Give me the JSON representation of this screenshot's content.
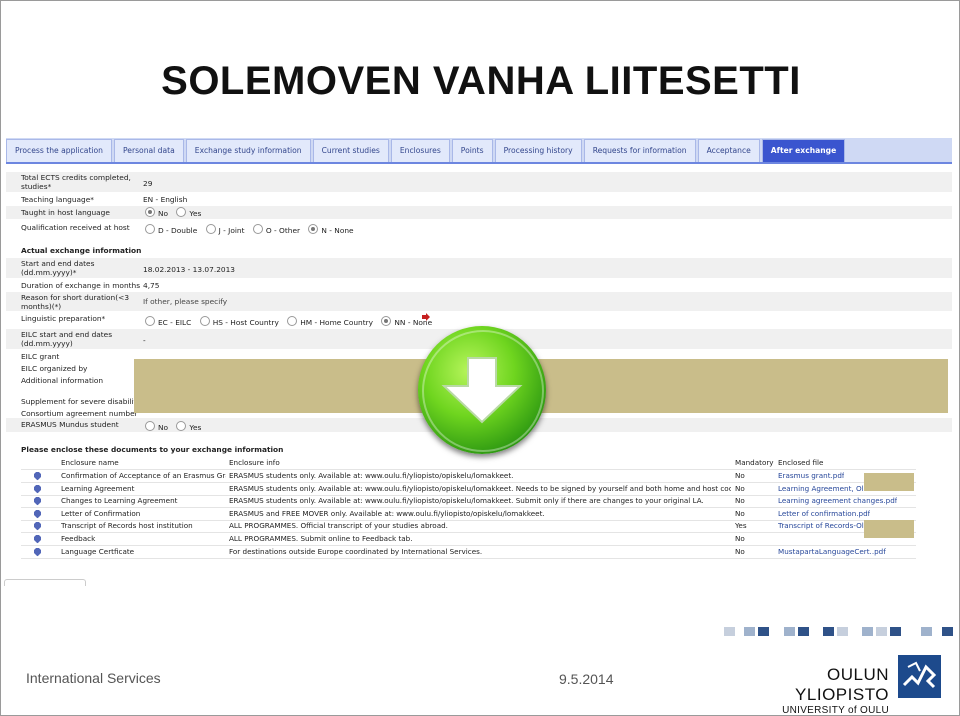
{
  "slide": {
    "title": "SOLEMOVEN VANHA LIITESETTI",
    "footer_left": "International Services",
    "footer_date": "9.5.2014",
    "university_name": "OULUN YLIOPISTO",
    "university_name_en": "UNIVERSITY of OULU",
    "accent_color": "#3a55cf",
    "redaction_color": "#c9bd8a"
  },
  "tabs": [
    {
      "label": "Process the application",
      "active": false
    },
    {
      "label": "Personal data",
      "active": false
    },
    {
      "label": "Exchange study information",
      "active": false
    },
    {
      "label": "Current studies",
      "active": false
    },
    {
      "label": "Enclosures",
      "active": false
    },
    {
      "label": "Points",
      "active": false
    },
    {
      "label": "Processing history",
      "active": false
    },
    {
      "label": "Requests for information",
      "active": false
    },
    {
      "label": "Acceptance",
      "active": false
    },
    {
      "label": "After exchange",
      "active": true
    }
  ],
  "form": {
    "total_ects_label": "Total ECTS credits completed, studies*",
    "total_ects_value": "29",
    "teaching_language_label": "Teaching language*",
    "teaching_language_value": "EN - English",
    "taught_host_label": "Taught in host language",
    "taught_host_options": [
      "No",
      "Yes"
    ],
    "qualification_label": "Qualification received at host",
    "qualification_options": [
      "D - Double",
      "J - Joint",
      "O - Other",
      "N - None"
    ],
    "actual_exchange_heading": "Actual exchange information",
    "start_end_label": "Start and end dates (dd.mm.yyyy)*",
    "start_end_value": "18.02.2013 - 13.07.2013",
    "duration_label": "Duration of exchange in months",
    "duration_value": "4,75",
    "short_reason_label": "Reason for short duration(<3 months)(*)",
    "short_reason_value": "If other, please specify",
    "linguistic_label": "Linguistic preparation*",
    "linguistic_options": [
      "EC - EILC",
      "HS - Host Country",
      "HM - Home Country",
      "NN - None"
    ],
    "eilc_dates_label": "EILC start and end dates (dd.mm.yyyy)",
    "eilc_dates_value": "-",
    "eilc_grant_label": "EILC grant",
    "eilc_org_label": "EILC organized by",
    "additional_label": "Additional information",
    "severe_label": "Supplement for severe disability",
    "consortium_label": "Consortium agreement number",
    "erasmus_mundus_label": "ERASMUS Mundus student",
    "erasmus_mundus_options": [
      "No",
      "Yes"
    ],
    "enclose_heading": "Please enclose these documents to your exchange information"
  },
  "enclosures": {
    "columns": [
      "Enclosure name",
      "Enclosure info",
      "Mandatory",
      "Enclosed file"
    ],
    "rows": [
      {
        "name": "Confirmation of Acceptance of an Erasmus Grant",
        "info": "ERASMUS students only. Available at: www.oulu.fi/yliopisto/opiskelu/lomakkeet.",
        "mandatory": "No",
        "file": "Erasmus grant.pdf"
      },
      {
        "name": "Learning Agreement",
        "info": "ERASMUS students only. Available at: www.oulu.fi/yliopisto/opiskelu/lomakkeet. Needs to be signed by yourself and both home and host coordinators.",
        "mandatory": "No",
        "file": "Learning Agreement, Olli"
      },
      {
        "name": "Changes to Learning Agreement",
        "info": "ERASMUS students only. Available at: www.oulu.fi/yliopisto/opiskelu/lomakkeet. Submit only if there are changes to your original LA.",
        "mandatory": "No",
        "file": "Learning agreement changes.pdf"
      },
      {
        "name": "Letter of Confirmation",
        "info": "ERASMUS and FREE MOVER only. Available at: www.oulu.fi/yliopisto/opiskelu/lomakkeet.",
        "mandatory": "No",
        "file": "Letter of confirmation.pdf"
      },
      {
        "name": "Transcript of Records host institution",
        "info": "ALL PROGRAMMES. Official transcript of your studies abroad.",
        "mandatory": "Yes",
        "file": "Transcript of Records-Olli"
      },
      {
        "name": "Feedback",
        "info": "ALL PROGRAMMES. Submit online to Feedback tab.",
        "mandatory": "No",
        "file": ""
      },
      {
        "name": "Language Certficate",
        "info": "For destinations outside Europe coordinated by International Services.",
        "mandatory": "No",
        "file": "MustapartaLanguageCert..pdf"
      }
    ]
  }
}
